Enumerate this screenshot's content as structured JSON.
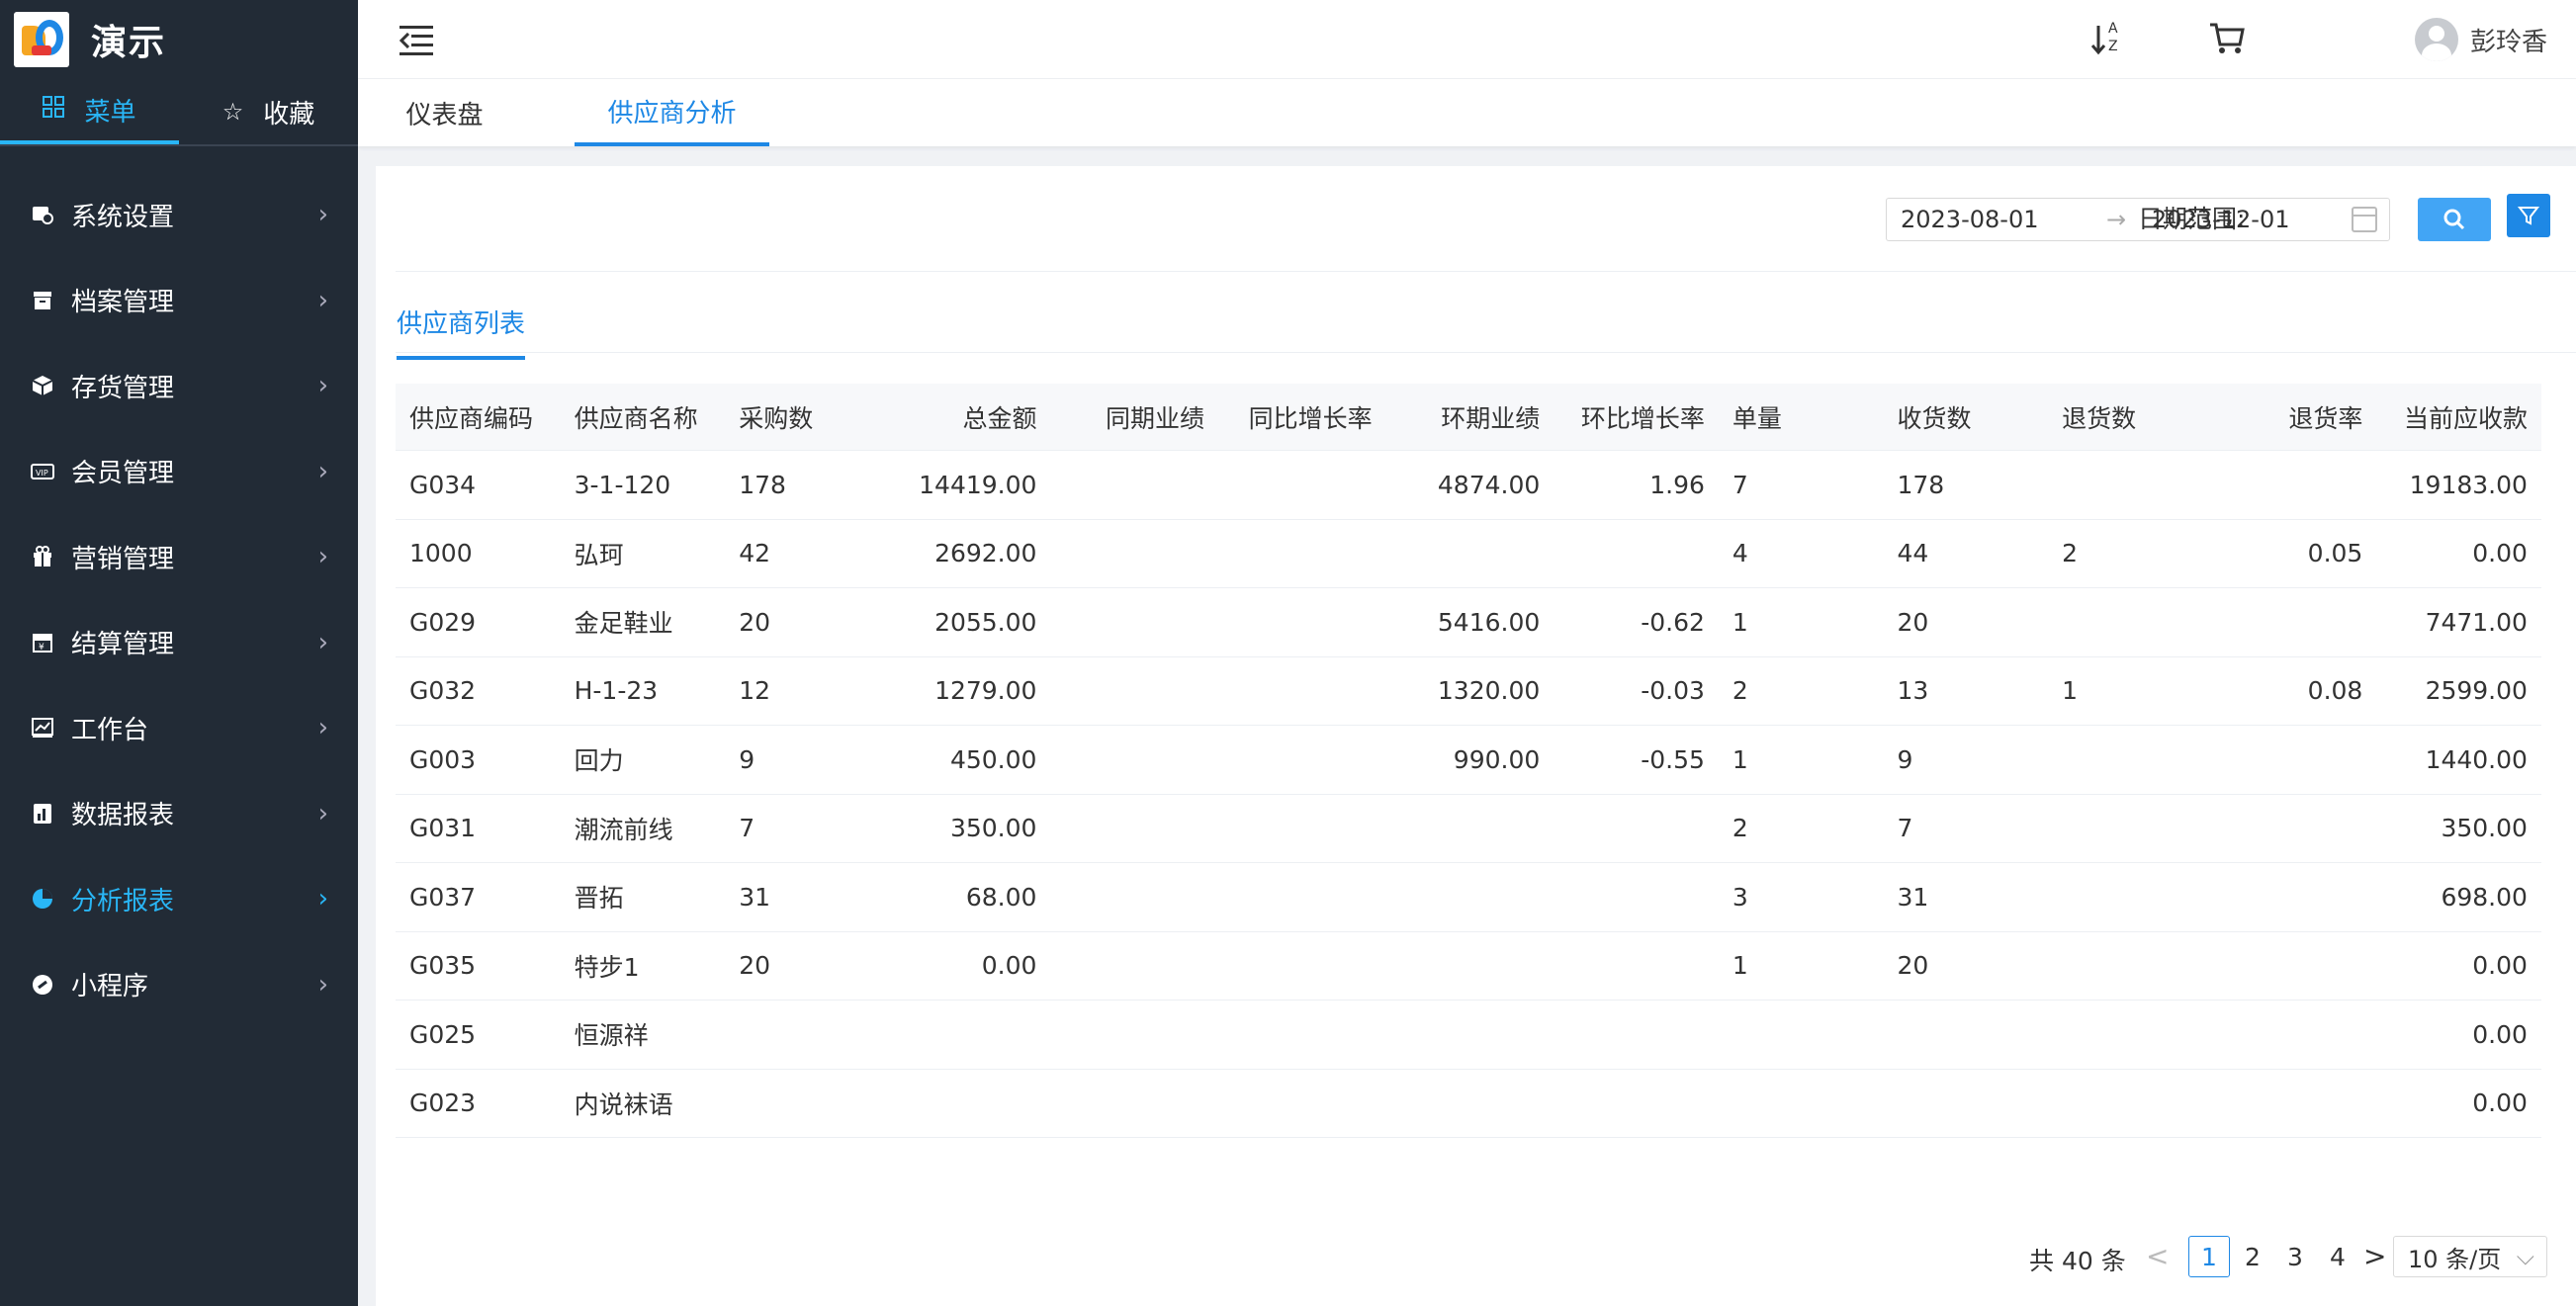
{
  "brand": {
    "name": "演示"
  },
  "side_tabs": [
    {
      "label": "菜单",
      "icon": "grid-icon",
      "active": true
    },
    {
      "label": "收藏",
      "icon": "star-icon",
      "active": false
    }
  ],
  "menu": [
    {
      "label": "系统设置",
      "icon": "settings-icon"
    },
    {
      "label": "档案管理",
      "icon": "archive-icon"
    },
    {
      "label": "存货管理",
      "icon": "box-icon"
    },
    {
      "label": "会员管理",
      "icon": "vip-card-icon"
    },
    {
      "label": "营销管理",
      "icon": "gift-icon"
    },
    {
      "label": "结算管理",
      "icon": "settlement-icon"
    },
    {
      "label": "工作台",
      "icon": "chart-line-icon"
    },
    {
      "label": "数据报表",
      "icon": "report-icon"
    },
    {
      "label": "分析报表",
      "icon": "pie-chart-icon",
      "active": true
    },
    {
      "label": "小程序",
      "icon": "link-icon"
    }
  ],
  "header": {
    "username": "彭玲香",
    "sort_label": "A Z"
  },
  "page_tabs": [
    {
      "label": "仪表盘",
      "active": false
    },
    {
      "label": "供应商分析",
      "active": true
    }
  ],
  "filter": {
    "label": "日期范围:",
    "start": "2023-08-01",
    "arrow": "→",
    "end": "2023-12-01"
  },
  "sub_tab": "供应商列表",
  "table": {
    "columns": [
      "供应商编码",
      "供应商名称",
      "采购数",
      "总金额",
      "同期业绩",
      "同比增长率",
      "环期业绩",
      "环比增长率",
      "单量",
      "收货数",
      "退货数",
      "退货率",
      "当前应收款"
    ],
    "rows": [
      [
        "G034",
        "3-1-120",
        "178",
        "14419.00",
        "",
        "",
        "4874.00",
        "1.96",
        "7",
        "178",
        "",
        "",
        "19183.00"
      ],
      [
        "1000",
        "弘珂",
        "42",
        "2692.00",
        "",
        "",
        "",
        "",
        "4",
        "44",
        "2",
        "0.05",
        "0.00"
      ],
      [
        "G029",
        "金足鞋业",
        "20",
        "2055.00",
        "",
        "",
        "5416.00",
        "-0.62",
        "1",
        "20",
        "",
        "",
        "7471.00"
      ],
      [
        "G032",
        "H-1-23",
        "12",
        "1279.00",
        "",
        "",
        "1320.00",
        "-0.03",
        "2",
        "13",
        "1",
        "0.08",
        "2599.00"
      ],
      [
        "G003",
        "回力",
        "9",
        "450.00",
        "",
        "",
        "990.00",
        "-0.55",
        "1",
        "9",
        "",
        "",
        "1440.00"
      ],
      [
        "G031",
        "潮流前线",
        "7",
        "350.00",
        "",
        "",
        "",
        "",
        "2",
        "7",
        "",
        "",
        "350.00"
      ],
      [
        "G037",
        "晋拓",
        "31",
        "68.00",
        "",
        "",
        "",
        "",
        "3",
        "31",
        "",
        "",
        "698.00"
      ],
      [
        "G035",
        "特步1",
        "20",
        "0.00",
        "",
        "",
        "",
        "",
        "1",
        "20",
        "",
        "",
        "0.00"
      ],
      [
        "G025",
        "恒源祥",
        "",
        "",
        "",
        "",
        "",
        "",
        "",
        "",
        "",
        "",
        "0.00"
      ],
      [
        "G023",
        "内说袜语",
        "",
        "",
        "",
        "",
        "",
        "",
        "",
        "",
        "",
        "",
        "0.00"
      ]
    ]
  },
  "pagination": {
    "total": "共 40 条",
    "prev": "<",
    "pages": [
      "1",
      "2",
      "3",
      "4"
    ],
    "current": "1",
    "next": ">",
    "page_size": "10 条/页"
  },
  "colors": {
    "sidebar": "#222b36",
    "accent": "#1e88e5",
    "menu_active": "#29b6f6"
  }
}
